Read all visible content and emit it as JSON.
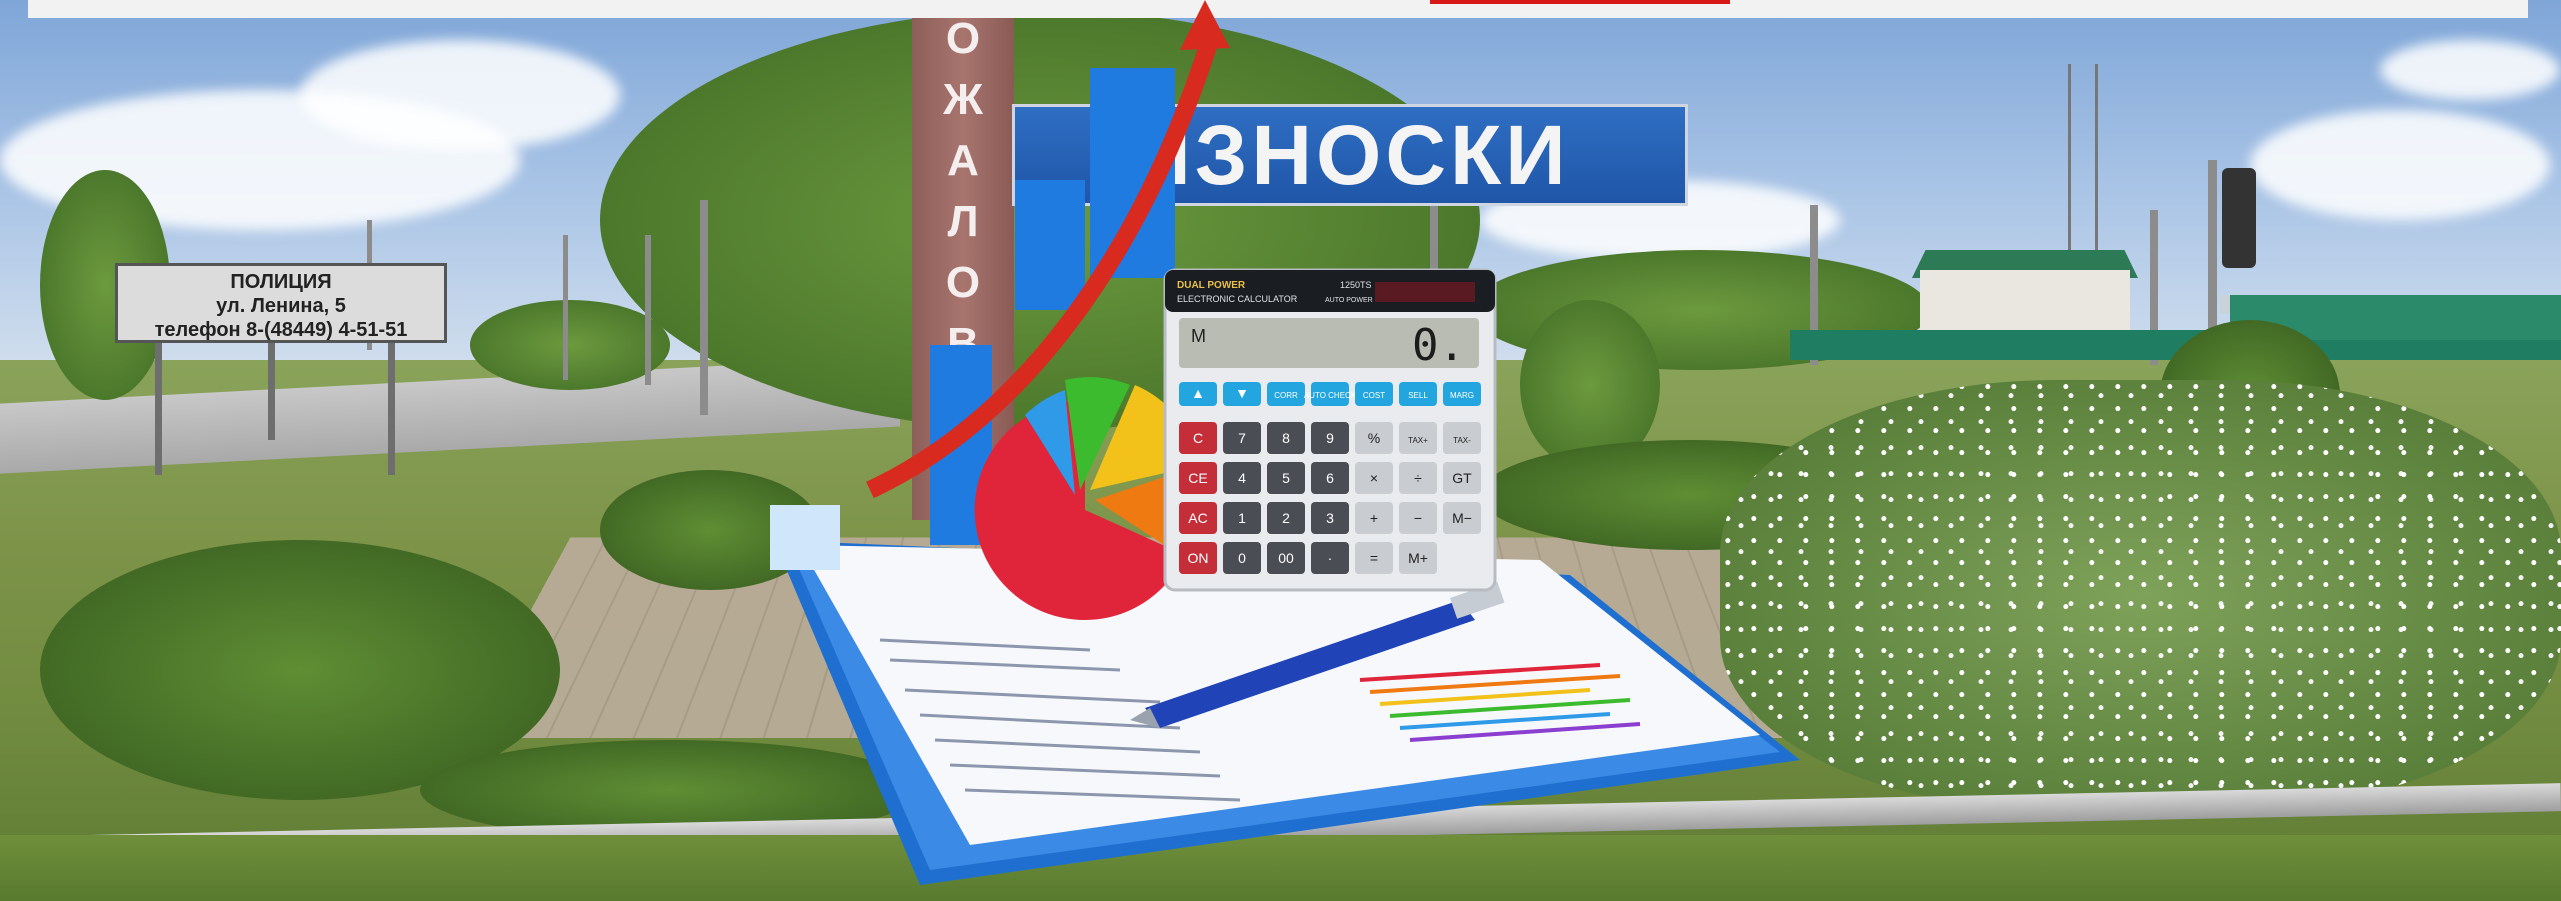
{
  "scene": {
    "description_tags": [
      "town-entry-sign",
      "financial-analytics-illustration"
    ]
  },
  "signs": {
    "city_name": "ИЗНОСКИ",
    "welcome_pillar": "ОЖАЛОВАТЬ",
    "police": {
      "line1": "ПОЛИЦИЯ",
      "line2": "ул. Ленина, 5",
      "line3": "телефон 8-(48449) 4-51-51"
    }
  },
  "calculator": {
    "brand_line1": "DUAL POWER",
    "brand_line2": "ELECTRONIC CALCULATOR",
    "auto_off": "AUTO POWER OFF",
    "model": "1250TS",
    "display_memory": "M",
    "display_value": "0.",
    "row1": [
      "▲",
      "▼",
      "CORR",
      "AUTO CHECK",
      "COST",
      "SELL",
      "MARG"
    ],
    "row2": [
      "C",
      "7",
      "8",
      "9",
      "%",
      "TAX+",
      "TAX-"
    ],
    "row3": [
      "CE",
      "4",
      "5",
      "6",
      "×",
      "÷",
      "GT"
    ],
    "row4": [
      "AC",
      "1",
      "2",
      "3",
      "+",
      "−",
      "M−"
    ],
    "row5": [
      "ON",
      "0",
      "00",
      "·",
      "=",
      "M+"
    ]
  },
  "colors": {
    "sign_blue": "#1f56a8",
    "pillar": "#9b6a64",
    "arrow": "#d82a1e",
    "bars": "#1f7be0",
    "pie": [
      "#e0243a",
      "#2f9ae8",
      "#3dbb2e",
      "#f2c21a",
      "#f07a12"
    ],
    "clipboard": "#1f6fd0"
  }
}
